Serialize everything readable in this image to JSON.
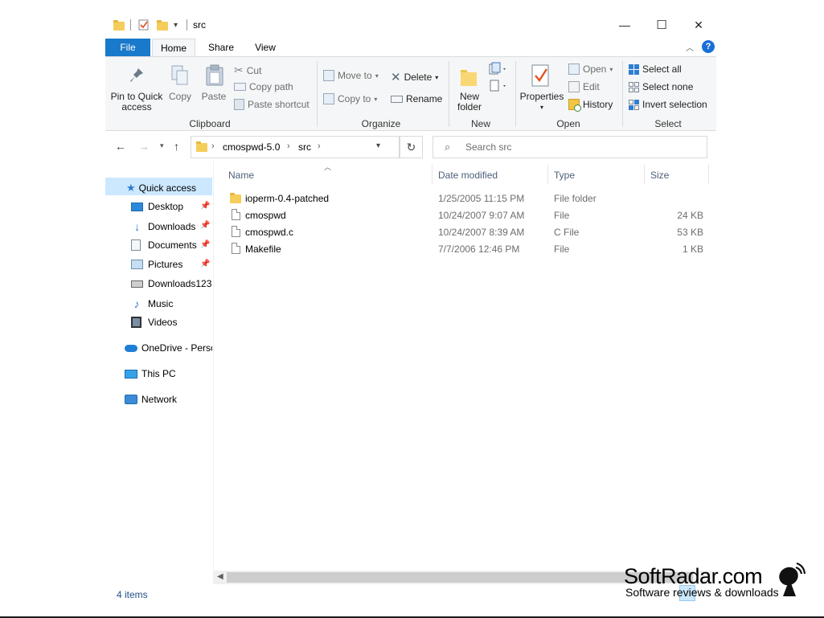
{
  "window": {
    "title": "src",
    "minimize": "—",
    "maximize": "☐",
    "close": "✕"
  },
  "ribbon_tabs": {
    "file": "File",
    "home": "Home",
    "share": "Share",
    "view": "View",
    "help": "?"
  },
  "clipboard": {
    "pin_line1": "Pin to Quick",
    "pin_line2": "access",
    "copy": "Copy",
    "paste": "Paste",
    "cut": "Cut",
    "copy_path": "Copy path",
    "paste_shortcut": "Paste shortcut",
    "label": "Clipboard"
  },
  "organize": {
    "move_to": "Move to",
    "copy_to": "Copy to",
    "delete": "Delete",
    "rename": "Rename",
    "label": "Organize"
  },
  "new": {
    "new_folder_line1": "New",
    "new_folder_line2": "folder",
    "label": "New"
  },
  "open": {
    "properties": "Properties",
    "open": "Open",
    "edit": "Edit",
    "history": "History",
    "label": "Open"
  },
  "select": {
    "select_all": "Select all",
    "select_none": "Select none",
    "invert_selection": "Invert selection",
    "label": "Select"
  },
  "address": {
    "crumbs": [
      "cmospwd-5.0",
      "src"
    ],
    "search_placeholder": "Search src"
  },
  "nav": {
    "quick_access": "Quick access",
    "items": [
      "Desktop",
      "Downloads",
      "Documents",
      "Pictures",
      "Downloads123",
      "Music",
      "Videos"
    ],
    "onedrive": "OneDrive - Perso",
    "this_pc": "This PC",
    "network": "Network"
  },
  "columns": {
    "name": "Name",
    "date": "Date modified",
    "type": "Type",
    "size": "Size"
  },
  "files": [
    {
      "name": "ioperm-0.4-patched",
      "date": "1/25/2005 11:15 PM",
      "type": "File folder",
      "size": "",
      "kind": "folder"
    },
    {
      "name": "cmospwd",
      "date": "10/24/2007 9:07 AM",
      "type": "File",
      "size": "24 KB",
      "kind": "file"
    },
    {
      "name": "cmospwd.c",
      "date": "10/24/2007 8:39 AM",
      "type": "C File",
      "size": "53 KB",
      "kind": "file"
    },
    {
      "name": "Makefile",
      "date": "7/7/2006 12:46 PM",
      "type": "File",
      "size": "1 KB",
      "kind": "file"
    }
  ],
  "status": {
    "items": "4 items"
  },
  "watermark": {
    "title": "SoftRadar.com",
    "subtitle": "Software reviews & downloads"
  }
}
